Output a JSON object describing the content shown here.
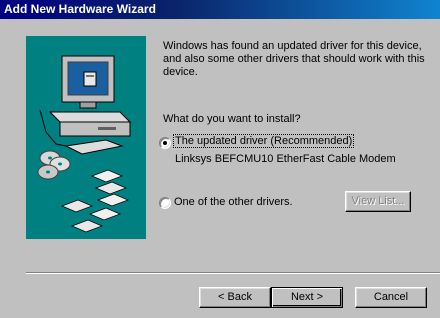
{
  "window": {
    "title": "Add New Hardware Wizard"
  },
  "intro": "Windows has found an updated driver for this device, and also some other drivers that should work with this device.",
  "question": "What do you want to install?",
  "options": [
    {
      "label": "The updated driver (Recommended)",
      "selected": true,
      "detail": "Linksys BEFCMU10 EtherFast Cable Modem"
    },
    {
      "label": "One of the other drivers.",
      "selected": false
    }
  ],
  "buttons": {
    "view_list": "View List...",
    "back": "< Back",
    "next": "Next >",
    "cancel": "Cancel"
  },
  "colors": {
    "title_bar": "#000080",
    "picture_bg": "#008080",
    "face": "#c0c0c0"
  },
  "icons": [
    "computer-icon",
    "cd-discs-icon",
    "floppy-disks-icon"
  ]
}
